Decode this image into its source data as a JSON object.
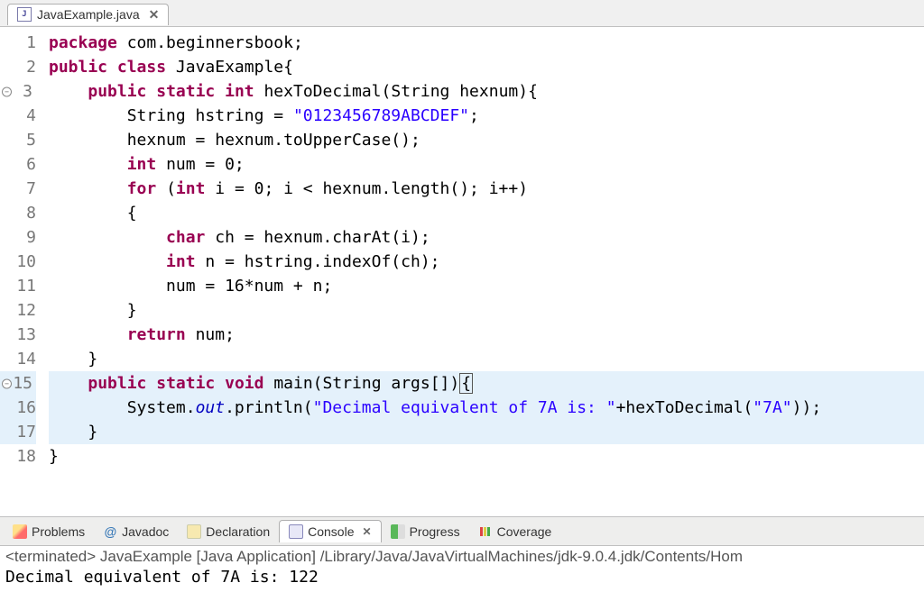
{
  "tab": {
    "filename": "JavaExample.java"
  },
  "code": {
    "lines": [
      {
        "n": "1",
        "fold": false,
        "hl": false,
        "tokens": [
          [
            "kw",
            "package"
          ],
          [
            "sp",
            " "
          ],
          [
            "ident",
            "com.beginnersbook"
          ],
          [
            "punct",
            ";"
          ]
        ]
      },
      {
        "n": "2",
        "fold": false,
        "hl": false,
        "tokens": [
          [
            "kw",
            "public"
          ],
          [
            "sp",
            " "
          ],
          [
            "kw",
            "class"
          ],
          [
            "sp",
            " "
          ],
          [
            "ident",
            "JavaExample"
          ],
          [
            "punct",
            "{"
          ]
        ]
      },
      {
        "n": "3",
        "fold": true,
        "hl": false,
        "indent": "    ",
        "tokens": [
          [
            "kw",
            "public"
          ],
          [
            "sp",
            " "
          ],
          [
            "kw",
            "static"
          ],
          [
            "sp",
            " "
          ],
          [
            "type",
            "int"
          ],
          [
            "sp",
            " "
          ],
          [
            "method",
            "hexToDecimal"
          ],
          [
            "punct",
            "("
          ],
          [
            "ident",
            "String hexnum"
          ],
          [
            "punct",
            "){"
          ]
        ]
      },
      {
        "n": "4",
        "fold": false,
        "hl": false,
        "indent": "        ",
        "tokens": [
          [
            "ident",
            "String hstring = "
          ],
          [
            "str",
            "\"0123456789ABCDEF\""
          ],
          [
            "punct",
            ";"
          ]
        ]
      },
      {
        "n": "5",
        "fold": false,
        "hl": false,
        "indent": "        ",
        "tokens": [
          [
            "ident",
            "hexnum = hexnum.toUpperCase();"
          ]
        ]
      },
      {
        "n": "6",
        "fold": false,
        "hl": false,
        "indent": "        ",
        "tokens": [
          [
            "type",
            "int"
          ],
          [
            "sp",
            " "
          ],
          [
            "ident",
            "num = 0;"
          ]
        ]
      },
      {
        "n": "7",
        "fold": false,
        "hl": false,
        "indent": "        ",
        "tokens": [
          [
            "kw",
            "for"
          ],
          [
            "sp",
            " "
          ],
          [
            "punct",
            "("
          ],
          [
            "type",
            "int"
          ],
          [
            "sp",
            " "
          ],
          [
            "ident",
            "i = 0; i < hexnum.length(); i++)"
          ]
        ]
      },
      {
        "n": "8",
        "fold": false,
        "hl": false,
        "indent": "        ",
        "tokens": [
          [
            "punct",
            "{"
          ]
        ]
      },
      {
        "n": "9",
        "fold": false,
        "hl": false,
        "indent": "            ",
        "tokens": [
          [
            "type",
            "char"
          ],
          [
            "sp",
            " "
          ],
          [
            "ident",
            "ch = hexnum.charAt(i);"
          ]
        ]
      },
      {
        "n": "10",
        "fold": false,
        "hl": false,
        "indent": "            ",
        "tokens": [
          [
            "type",
            "int"
          ],
          [
            "sp",
            " "
          ],
          [
            "ident",
            "n = hstring.indexOf(ch);"
          ]
        ]
      },
      {
        "n": "11",
        "fold": false,
        "hl": false,
        "indent": "            ",
        "tokens": [
          [
            "ident",
            "num = 16*num + n;"
          ]
        ]
      },
      {
        "n": "12",
        "fold": false,
        "hl": false,
        "indent": "        ",
        "tokens": [
          [
            "punct",
            "}"
          ]
        ]
      },
      {
        "n": "13",
        "fold": false,
        "hl": false,
        "indent": "        ",
        "tokens": [
          [
            "kw",
            "return"
          ],
          [
            "sp",
            " "
          ],
          [
            "ident",
            "num;"
          ]
        ]
      },
      {
        "n": "14",
        "fold": false,
        "hl": false,
        "indent": "    ",
        "tokens": [
          [
            "punct",
            "}"
          ]
        ]
      },
      {
        "n": "15",
        "fold": true,
        "hl": true,
        "indent": "    ",
        "tokens": [
          [
            "kw",
            "public"
          ],
          [
            "sp",
            " "
          ],
          [
            "kw",
            "static"
          ],
          [
            "sp",
            " "
          ],
          [
            "type",
            "void"
          ],
          [
            "sp",
            " "
          ],
          [
            "method",
            "main"
          ],
          [
            "punct",
            "("
          ],
          [
            "ident",
            "String args[]"
          ],
          [
            "punct",
            ")"
          ],
          [
            "cursor-braces",
            "{"
          ]
        ]
      },
      {
        "n": "16",
        "fold": false,
        "hl": true,
        "indent": "        ",
        "tokens": [
          [
            "ident",
            "System."
          ],
          [
            "field-static",
            "out"
          ],
          [
            "ident",
            ".println("
          ],
          [
            "str",
            "\"Decimal equivalent of 7A is: \""
          ],
          [
            "ident",
            "+hexToDecimal("
          ],
          [
            "str",
            "\"7A\""
          ],
          [
            "ident",
            "));"
          ]
        ]
      },
      {
        "n": "17",
        "fold": false,
        "hl": true,
        "indent": "    ",
        "tokens": [
          [
            "punct",
            "}"
          ]
        ]
      },
      {
        "n": "18",
        "fold": false,
        "hl": false,
        "tokens": [
          [
            "punct",
            "}"
          ]
        ]
      }
    ]
  },
  "bottomTabs": {
    "problems": "Problems",
    "javadoc": "Javadoc",
    "declaration": "Declaration",
    "console": "Console",
    "progress": "Progress",
    "coverage": "Coverage"
  },
  "console": {
    "header": "<terminated> JavaExample [Java Application] /Library/Java/JavaVirtualMachines/jdk-9.0.4.jdk/Contents/Hom",
    "output": "Decimal equivalent of 7A is: 122"
  }
}
